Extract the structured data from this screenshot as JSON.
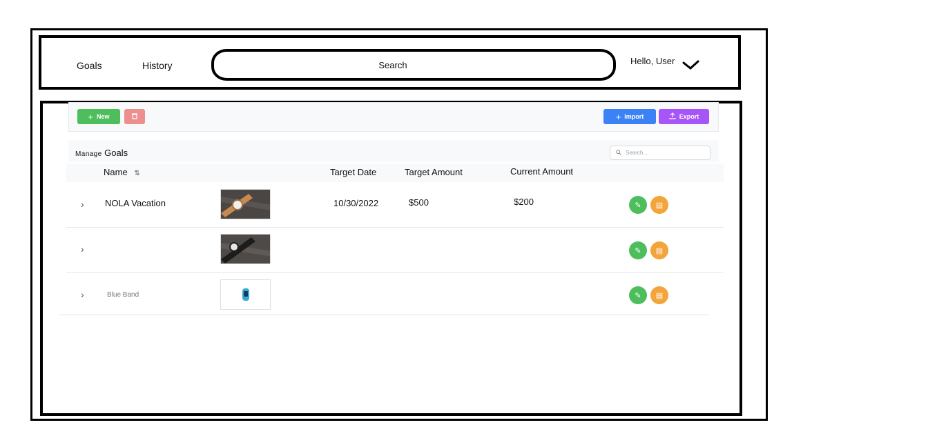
{
  "nav": {
    "goals": "Goals",
    "history": "History"
  },
  "search": {
    "label": "Search"
  },
  "user": {
    "greeting": "Hello, User",
    "menu_icon": "chevron-down-icon"
  },
  "toolbar": {
    "new_label": "New",
    "import_label": "Import",
    "export_label": "Export",
    "colors": {
      "new": "#4ebd5c",
      "delete": "#ee8f8f",
      "import": "#3b82f6",
      "export": "#a855f7"
    }
  },
  "manage": {
    "prefix": "Manage",
    "title": "Goals",
    "search_placeholder": "Search..."
  },
  "table": {
    "columns": {
      "name": "Name",
      "sort_icon": "⇅",
      "target_date": "Target Date",
      "target_amount": "Target Amount",
      "current_amount": "Current Amount"
    },
    "rows": [
      {
        "name": "NOLA Vacation",
        "target_date": "10/30/2022",
        "target_amount": "$500",
        "current_amount": "$200",
        "image": "watch-brown-strap"
      },
      {
        "name": "",
        "target_date": "",
        "target_amount": "",
        "current_amount": "",
        "image": "watch-black-strap"
      },
      {
        "name": "Blue Band",
        "target_date": "",
        "target_amount": "",
        "current_amount": "",
        "image": "blue-fitness-band"
      }
    ]
  }
}
